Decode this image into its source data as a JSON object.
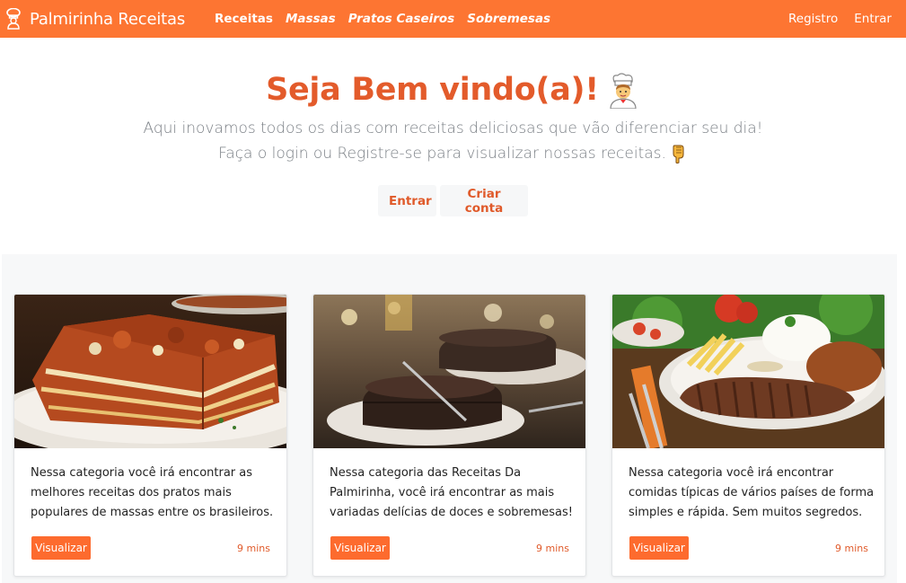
{
  "colors": {
    "accent": "#fd7532",
    "title": "#e35b2b",
    "button": "#fd6b2e"
  },
  "navbar": {
    "brand": "Palmirinha Receitas",
    "brand_icon": "chef-icon",
    "links": [
      "Receitas",
      "Massas",
      "Pratos Caseiros",
      "Sobremesas"
    ],
    "right": [
      "Registro",
      "Entrar"
    ]
  },
  "hero": {
    "title": "Seja Bem vindo(a)!",
    "title_icon": "cook-emoji-icon",
    "line1": "Aqui inovamos todos os dias com receitas deliciosas que vão diferenciar seu dia!",
    "line2": "Faça o login ou Registre-se para visualizar nossas receitas.",
    "line2_icon": "pointing-down-icon",
    "btn_login": "Entrar",
    "btn_register": "Criar conta"
  },
  "cards": [
    {
      "image": "lasagna-photo",
      "text": "Nessa categoria você irá encontrar as melhores receitas dos pratos mais populares de massas entre os brasileiros.",
      "button": "Visualizar",
      "time": "9 mins"
    },
    {
      "image": "chocolate-cake-photo",
      "text": "Nessa categoria das Receitas Da Palmirinha, você irá encontrar as mais variadas delícias de doces e sobremesas!",
      "button": "Visualizar",
      "time": "9 mins"
    },
    {
      "image": "rice-beans-steak-photo",
      "text": "Nessa categoria você irá encontrar comidas típicas de vários países de forma simples e rápida. Sem muitos segredos.",
      "button": "Visualizar",
      "time": "9 mins"
    }
  ]
}
